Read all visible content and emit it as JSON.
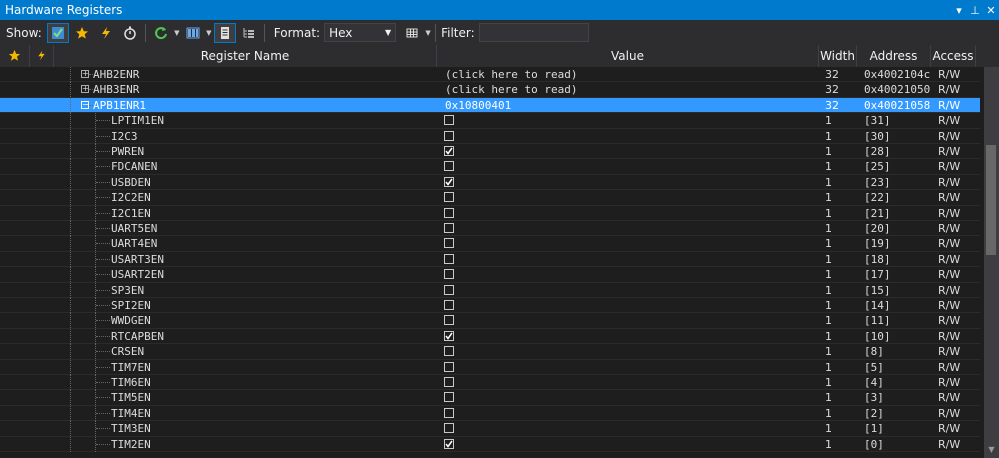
{
  "window": {
    "title": "Hardware Registers",
    "ctrl_dropdown": "▾",
    "ctrl_pin": "⊥",
    "ctrl_close": "✕"
  },
  "toolbar": {
    "show_label": "Show:",
    "format_label": "Format:",
    "format_value": "Hex",
    "filter_label": "Filter:",
    "filter_value": ""
  },
  "columns": {
    "name": "Register Name",
    "value": "Value",
    "width": "Width",
    "address": "Address",
    "access": "Access"
  },
  "rows": [
    {
      "name": "AHB2ENR",
      "value": "(click here to read)",
      "width": "32",
      "address": "0x4002104c",
      "access": "R/W",
      "kind": "register",
      "expander": "+"
    },
    {
      "name": "AHB3ENR",
      "value": "(click here to read)",
      "width": "32",
      "address": "0x40021050",
      "access": "R/W",
      "kind": "register",
      "expander": "+"
    },
    {
      "name": "APB1ENR1",
      "value": "0x10800401",
      "width": "32",
      "address": "0x40021058",
      "access": "R/W",
      "kind": "register",
      "expander": "-",
      "selected": true
    },
    {
      "name": "LPTIM1EN",
      "checked": false,
      "width": "1",
      "address": "[31]",
      "access": "R/W",
      "kind": "bit"
    },
    {
      "name": "I2C3",
      "checked": false,
      "width": "1",
      "address": "[30]",
      "access": "R/W",
      "kind": "bit"
    },
    {
      "name": "PWREN",
      "checked": true,
      "width": "1",
      "address": "[28]",
      "access": "R/W",
      "kind": "bit"
    },
    {
      "name": "FDCANEN",
      "checked": false,
      "width": "1",
      "address": "[25]",
      "access": "R/W",
      "kind": "bit"
    },
    {
      "name": "USBDEN",
      "checked": true,
      "width": "1",
      "address": "[23]",
      "access": "R/W",
      "kind": "bit"
    },
    {
      "name": "I2C2EN",
      "checked": false,
      "width": "1",
      "address": "[22]",
      "access": "R/W",
      "kind": "bit"
    },
    {
      "name": "I2C1EN",
      "checked": false,
      "width": "1",
      "address": "[21]",
      "access": "R/W",
      "kind": "bit"
    },
    {
      "name": "UART5EN",
      "checked": false,
      "width": "1",
      "address": "[20]",
      "access": "R/W",
      "kind": "bit"
    },
    {
      "name": "UART4EN",
      "checked": false,
      "width": "1",
      "address": "[19]",
      "access": "R/W",
      "kind": "bit"
    },
    {
      "name": "USART3EN",
      "checked": false,
      "width": "1",
      "address": "[18]",
      "access": "R/W",
      "kind": "bit"
    },
    {
      "name": "USART2EN",
      "checked": false,
      "width": "1",
      "address": "[17]",
      "access": "R/W",
      "kind": "bit"
    },
    {
      "name": "SP3EN",
      "checked": false,
      "width": "1",
      "address": "[15]",
      "access": "R/W",
      "kind": "bit"
    },
    {
      "name": "SPI2EN",
      "checked": false,
      "width": "1",
      "address": "[14]",
      "access": "R/W",
      "kind": "bit"
    },
    {
      "name": "WWDGEN",
      "checked": false,
      "width": "1",
      "address": "[11]",
      "access": "R/W",
      "kind": "bit"
    },
    {
      "name": "RTCAPBEN",
      "checked": true,
      "width": "1",
      "address": "[10]",
      "access": "R/W",
      "kind": "bit"
    },
    {
      "name": "CRSEN",
      "checked": false,
      "width": "1",
      "address": "[8]",
      "access": "R/W",
      "kind": "bit"
    },
    {
      "name": "TIM7EN",
      "checked": false,
      "width": "1",
      "address": "[5]",
      "access": "R/W",
      "kind": "bit"
    },
    {
      "name": "TIM6EN",
      "checked": false,
      "width": "1",
      "address": "[4]",
      "access": "R/W",
      "kind": "bit"
    },
    {
      "name": "TIM5EN",
      "checked": false,
      "width": "1",
      "address": "[3]",
      "access": "R/W",
      "kind": "bit"
    },
    {
      "name": "TIM4EN",
      "checked": false,
      "width": "1",
      "address": "[2]",
      "access": "R/W",
      "kind": "bit"
    },
    {
      "name": "TIM3EN",
      "checked": false,
      "width": "1",
      "address": "[1]",
      "access": "R/W",
      "kind": "bit"
    },
    {
      "name": "TIM2EN",
      "checked": true,
      "width": "1",
      "address": "[0]",
      "access": "R/W",
      "kind": "bit"
    }
  ],
  "colors": {
    "accent": "#007acc",
    "selection": "#3399ff",
    "background": "#1e1e1e",
    "toolbar": "#2d2d30"
  }
}
